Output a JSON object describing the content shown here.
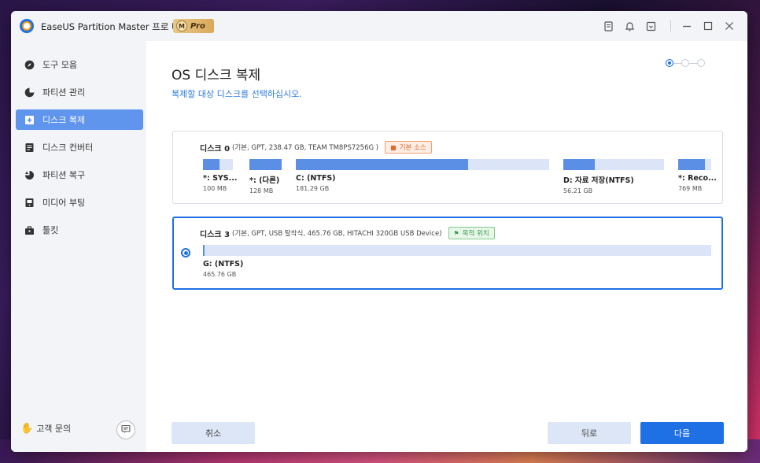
{
  "window": {
    "app_title": "EaseUS Partition Master 프로 버전",
    "badge_letter": "M",
    "badge_label": "Pro"
  },
  "titlebar_icons": [
    "notes-icon",
    "bell-icon",
    "export-icon",
    "minimize-icon",
    "maximize-icon",
    "close-icon"
  ],
  "sidebar": {
    "items": [
      {
        "label": "도구 모음",
        "icon": "compass-icon",
        "active": false
      },
      {
        "label": "파티션 관리",
        "icon": "pie-chart-icon",
        "active": false
      },
      {
        "label": "디스크 복제",
        "icon": "clone-icon",
        "active": true
      },
      {
        "label": "디스크 컨버터",
        "icon": "converter-icon",
        "active": false
      },
      {
        "label": "파티션 복구",
        "icon": "recovery-icon",
        "active": false
      },
      {
        "label": "미디어 부팅",
        "icon": "media-boot-icon",
        "active": false
      },
      {
        "label": "툴킷",
        "icon": "toolkit-icon",
        "active": false
      }
    ],
    "support_label": "고객 문의"
  },
  "main": {
    "title": "OS 디스크 복제",
    "subtitle": "복제할 대상 디스크를 선택하십시오.",
    "steps": {
      "total": 3,
      "current": 1
    }
  },
  "disks": [
    {
      "name": "디스크 0",
      "detail": "(기본, GPT, 238.47 GB, TEAM TM8PS7256G )",
      "tag": "기본 소스",
      "tag_type": "source",
      "selected": false,
      "partitions": [
        {
          "label": "*: SYS...",
          "size": "100 MB",
          "used": 0.55
        },
        {
          "label": "*: (다른)",
          "size": "128 MB",
          "used": 1.0
        },
        {
          "label": "C: (NTFS)",
          "size": "181.29 GB",
          "used": 0.68
        },
        {
          "label": "D: 자료 저장(NTFS)",
          "size": "56.21 GB",
          "used": 0.31
        },
        {
          "label": "*: Reco...",
          "size": "769 MB",
          "used": 0.82
        }
      ]
    },
    {
      "name": "디스크 3",
      "detail": "(기본, GPT, USB 탈착식, 465.76 GB, HITACHI 320GB USB Device)",
      "tag": "목적 위치",
      "tag_type": "target",
      "selected": true,
      "partitions": [
        {
          "label": "G: (NTFS)",
          "size": "465.76 GB",
          "used": 0.003
        }
      ]
    }
  ],
  "buttons": {
    "cancel": "취소",
    "back": "뒤로",
    "next": "다음"
  },
  "colors": {
    "accent": "#1f6fe5",
    "sidebar_active": "#5f95ec",
    "partition_fill": "#5b8fe6",
    "partition_free": "#dbe5f7"
  }
}
